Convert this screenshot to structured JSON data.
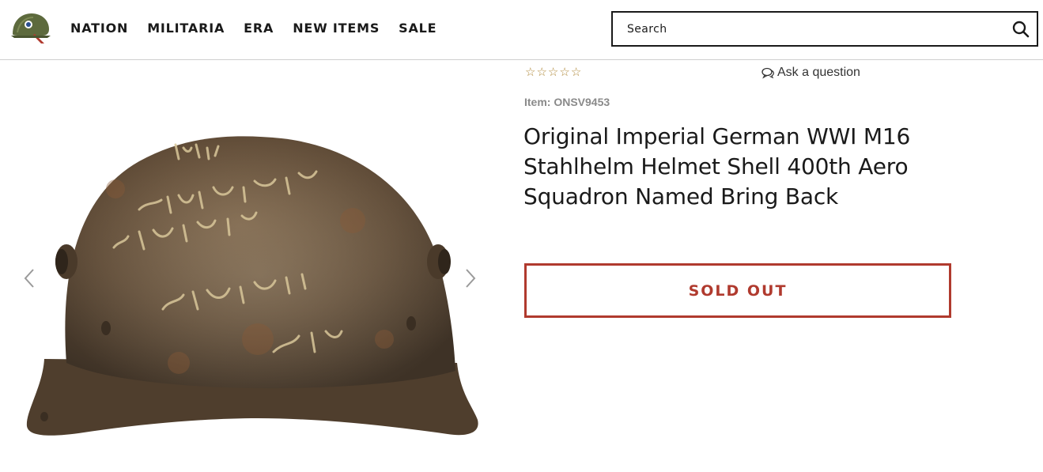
{
  "header": {
    "logo_icon": "army-helmet-logo-icon",
    "nav": [
      {
        "label": "NATION"
      },
      {
        "label": "MILITARIA"
      },
      {
        "label": "ERA"
      },
      {
        "label": "NEW ITEMS"
      },
      {
        "label": "SALE"
      }
    ],
    "search": {
      "placeholder": "Search",
      "value": "",
      "icon": "search-icon"
    }
  },
  "gallery": {
    "image_description_icon": "helmet-photo",
    "prev_icon": "chevron-left-icon",
    "next_icon": "chevron-right-icon",
    "helmet_inscription": [
      "To- E.E.Taylor",
      "460 So. 1st St.",
      "Fulton New York",
      "U.S.A."
    ]
  },
  "product": {
    "rating": {
      "stars": 0,
      "max": 5
    },
    "ask_question": "Ask a question",
    "item_prefix": "Item: ",
    "item_code": "ONSV9453",
    "title": "Original Imperial German WWI M16 Stahlhelm Helmet Shell 400th Aero Squadron Named Bring Back",
    "button_label": "SOLD OUT"
  },
  "colors": {
    "accent": "#b03a2e",
    "star": "#b08a3c",
    "text": "#1a1a1a",
    "muted": "#8a8a8a"
  }
}
